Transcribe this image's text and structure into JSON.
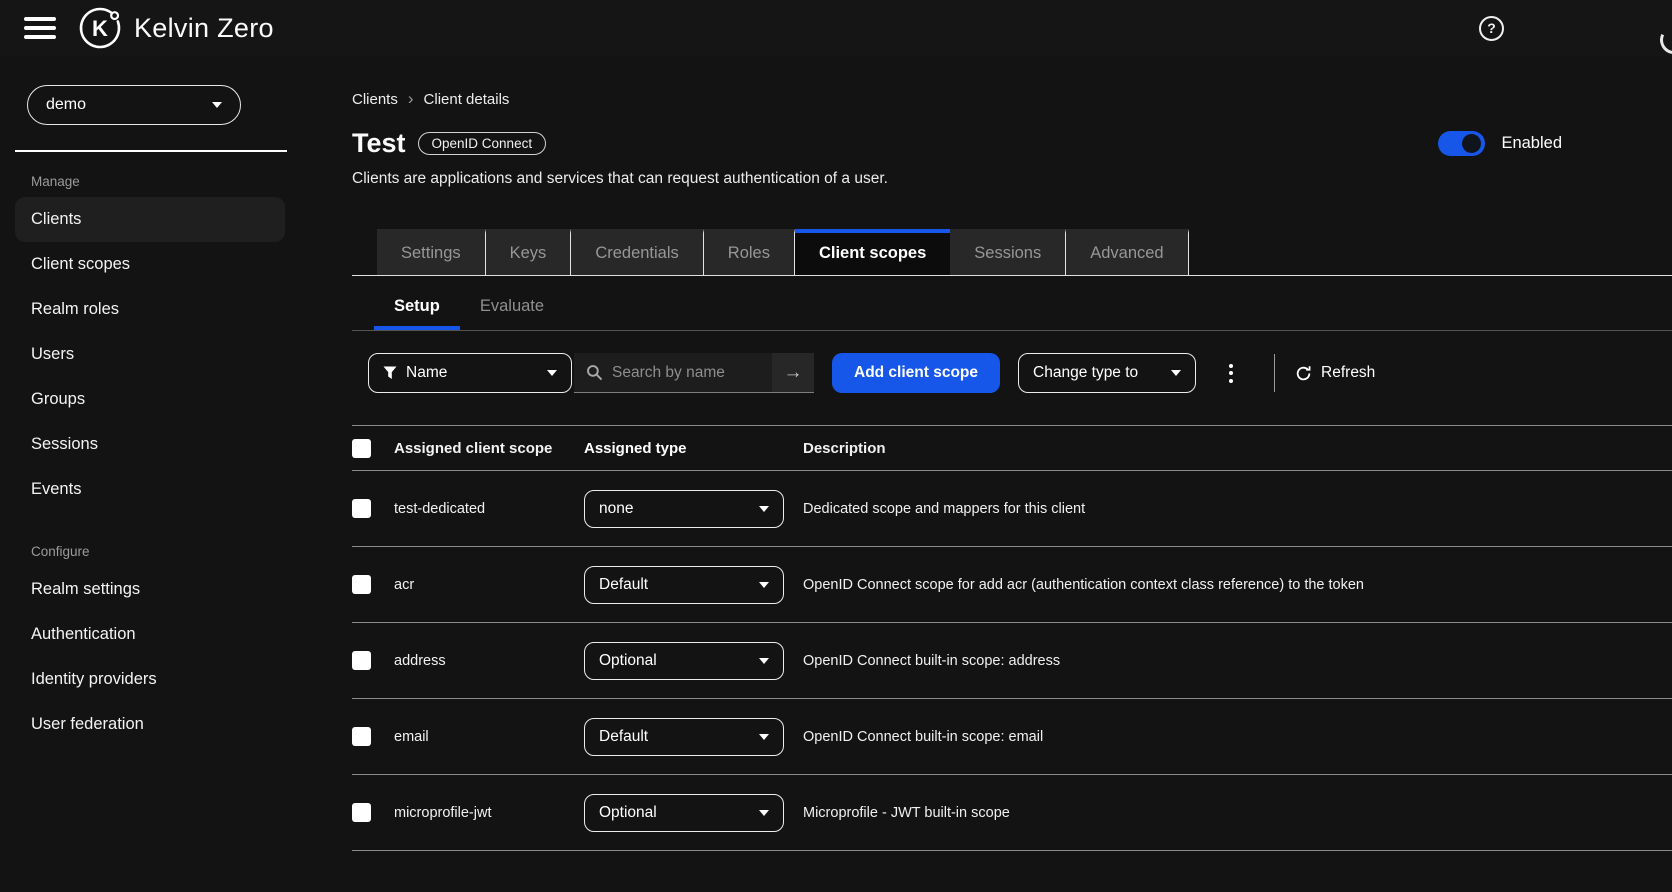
{
  "colors": {
    "accent": "#1657e9",
    "background": "#131313"
  },
  "header": {
    "brand": "Kelvin Zero",
    "help_glyph": "?"
  },
  "sidebar": {
    "realm": "demo",
    "sections": [
      {
        "label": "Manage",
        "items": [
          "Clients",
          "Client scopes",
          "Realm roles",
          "Users",
          "Groups",
          "Sessions",
          "Events"
        ],
        "active_item": "Clients"
      },
      {
        "label": "Configure",
        "items": [
          "Realm settings",
          "Authentication",
          "Identity providers",
          "User federation"
        ]
      }
    ]
  },
  "breadcrumb": {
    "parent": "Clients",
    "current": "Client details",
    "separator": "›"
  },
  "page": {
    "title": "Test",
    "protocol_badge": "OpenID Connect",
    "description": "Clients are applications and services that can request authentication of a user.",
    "enabled_label": "Enabled",
    "enabled_state": true
  },
  "tabs": {
    "items": [
      "Settings",
      "Keys",
      "Credentials",
      "Roles",
      "Client scopes",
      "Sessions",
      "Advanced"
    ],
    "active": "Client scopes"
  },
  "subtabs": {
    "items": [
      "Setup",
      "Evaluate"
    ],
    "active": "Setup"
  },
  "toolbar": {
    "filter_label": "Name",
    "search_placeholder": "Search by name",
    "search_arrow_glyph": "→",
    "add_button_label": "Add client scope",
    "change_type_label": "Change type to",
    "refresh_label": "Refresh"
  },
  "table": {
    "columns": [
      "Assigned client scope",
      "Assigned type",
      "Description"
    ],
    "rows": [
      {
        "scope": "test-dedicated",
        "assigned_type": "none",
        "description": "Dedicated scope and mappers for this client"
      },
      {
        "scope": "acr",
        "assigned_type": "Default",
        "description": "OpenID Connect scope for add acr (authentication context class reference) to the token"
      },
      {
        "scope": "address",
        "assigned_type": "Optional",
        "description": "OpenID Connect built-in scope: address"
      },
      {
        "scope": "email",
        "assigned_type": "Default",
        "description": "OpenID Connect built-in scope: email"
      },
      {
        "scope": "microprofile-jwt",
        "assigned_type": "Optional",
        "description": "Microprofile - JWT built-in scope"
      }
    ]
  }
}
